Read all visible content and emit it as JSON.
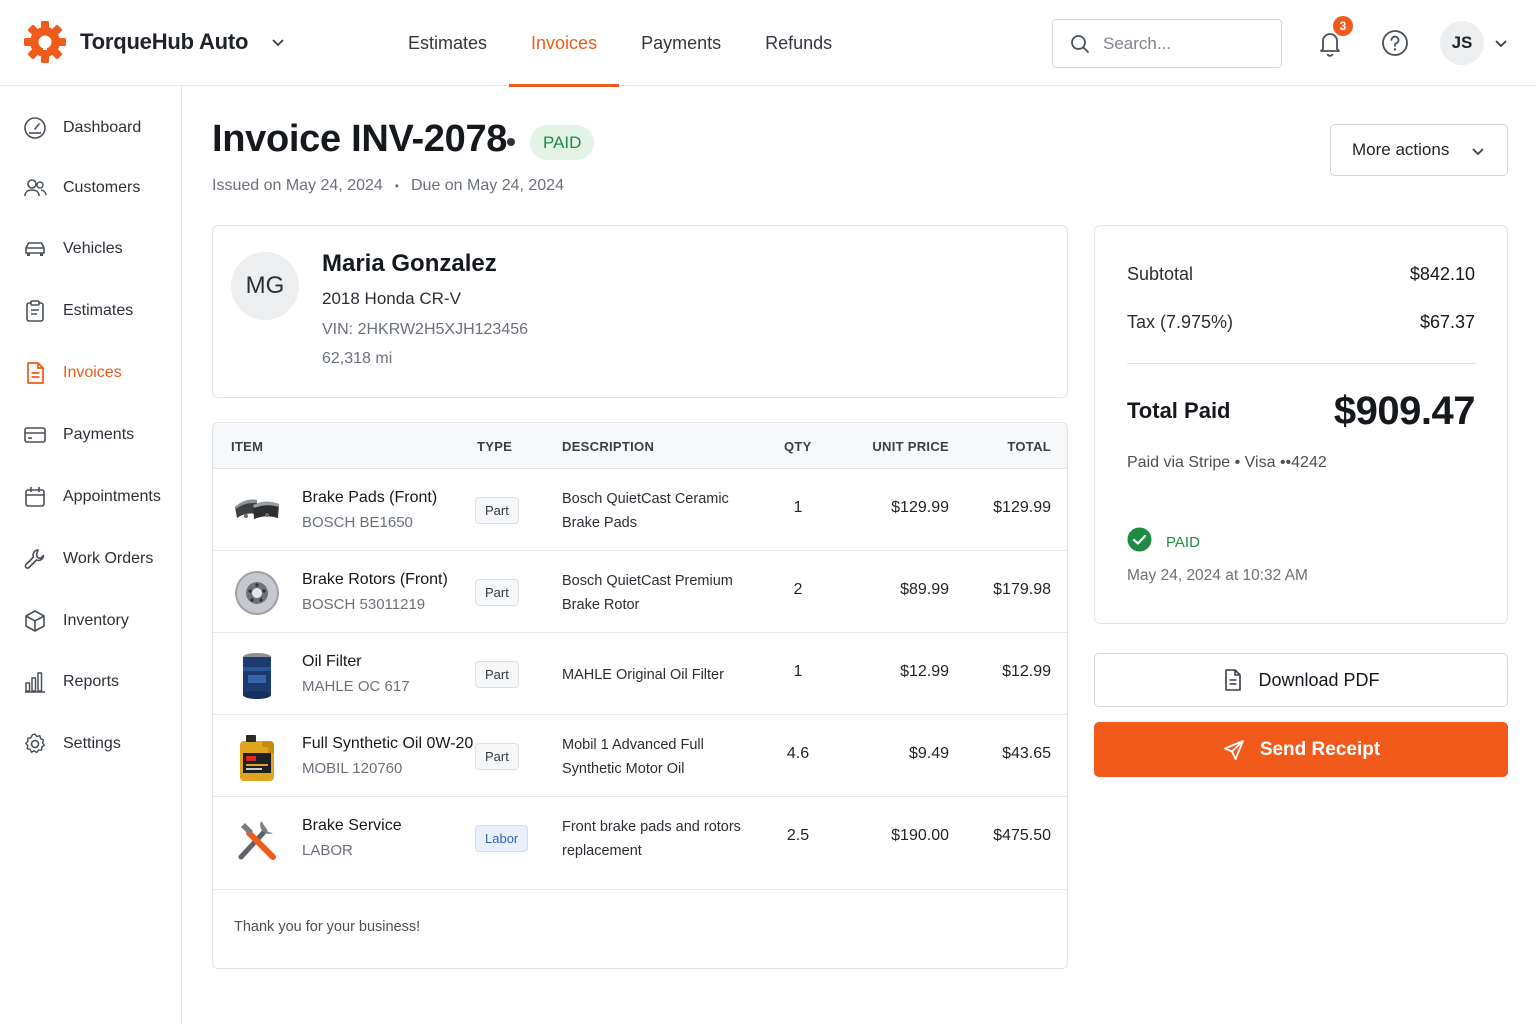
{
  "brand": {
    "name": "TorqueHub Auto",
    "accent": "#f05a1a"
  },
  "nav": {
    "tabs": [
      {
        "label": "Estimates"
      },
      {
        "label": "Invoices",
        "active": true
      },
      {
        "label": "Payments"
      },
      {
        "label": "Refunds"
      }
    ]
  },
  "search": {
    "placeholder": "Search..."
  },
  "notifications": {
    "count": "3"
  },
  "user": {
    "initials": "JS"
  },
  "sidebar": {
    "items": [
      {
        "label": "Dashboard",
        "icon": "gauge-icon"
      },
      {
        "label": "Customers",
        "icon": "users-icon"
      },
      {
        "label": "Vehicles",
        "icon": "car-icon"
      },
      {
        "label": "Estimates",
        "icon": "clipboard-icon"
      },
      {
        "label": "Invoices",
        "icon": "invoice-icon",
        "active": true
      },
      {
        "label": "Payments",
        "icon": "card-icon"
      },
      {
        "label": "Appointments",
        "icon": "calendar-icon"
      },
      {
        "label": "Work Orders",
        "icon": "wrench-icon"
      },
      {
        "label": "Inventory",
        "icon": "box-icon"
      },
      {
        "label": "Reports",
        "icon": "bar-chart-icon"
      },
      {
        "label": "Settings",
        "icon": "gear-icon"
      }
    ]
  },
  "invoice": {
    "title": "Invoice INV-2078",
    "status": "PAID",
    "issued": "Issued on May 24, 2024",
    "due": "Due on May 24, 2024",
    "more_actions": "More actions"
  },
  "customer": {
    "initials": "MG",
    "name": "Maria Gonzalez",
    "vehicle": "2018 Honda CR-V",
    "vin": "VIN: 2HKRW2H5XJH123456",
    "mileage": "62,318 mi"
  },
  "items": {
    "headers": {
      "item": "ITEM",
      "type": "TYPE",
      "description": "DESCRIPTION",
      "qty": "QTY",
      "unit_price": "UNIT PRICE",
      "total": "TOTAL"
    },
    "rows": [
      {
        "name": "Brake Pads (Front)",
        "sku": "BOSCH BE1650",
        "type": "Part",
        "description": "Bosch QuietCast Ceramic Brake Pads",
        "qty": "1",
        "unit_price": "$129.99",
        "total": "$129.99",
        "thumb": "brake-pads-icon"
      },
      {
        "name": "Brake Rotors (Front)",
        "sku": "BOSCH 53011219",
        "type": "Part",
        "description": "Bosch QuietCast Premium Brake Rotor",
        "qty": "2",
        "unit_price": "$89.99",
        "total": "$179.98",
        "thumb": "brake-rotor-icon"
      },
      {
        "name": "Oil Filter",
        "sku": "MAHLE OC 617",
        "type": "Part",
        "description": "MAHLE Original Oil Filter",
        "qty": "1",
        "unit_price": "$12.99",
        "total": "$12.99",
        "thumb": "oil-filter-icon"
      },
      {
        "name": "Full Synthetic Oil 0W-20",
        "sku": "MOBIL 120760",
        "type": "Part",
        "description": "Mobil 1 Advanced Full Synthetic Motor Oil",
        "qty": "4.6",
        "unit_price": "$9.49",
        "total": "$43.65",
        "thumb": "oil-jug-icon"
      },
      {
        "name": "Brake Service",
        "sku": "LABOR",
        "type": "Labor",
        "description": "Front brake pads and rotors replacement",
        "qty": "2.5",
        "unit_price": "$190.00",
        "total": "$475.50",
        "thumb": "tools-icon"
      }
    ],
    "footer_note": "Thank you for your business!"
  },
  "summary": {
    "subtotal_label": "Subtotal",
    "subtotal": "$842.10",
    "tax_label": "Tax (7.975%)",
    "tax": "$67.37",
    "total_label": "Total Paid",
    "total": "$909.47",
    "paid_via": "Paid via Stripe • Visa ••4242",
    "status": "PAID",
    "paid_at": "May 24, 2024 at 10:32 AM"
  },
  "actions": {
    "download": "Download PDF",
    "send": "Send Receipt"
  }
}
